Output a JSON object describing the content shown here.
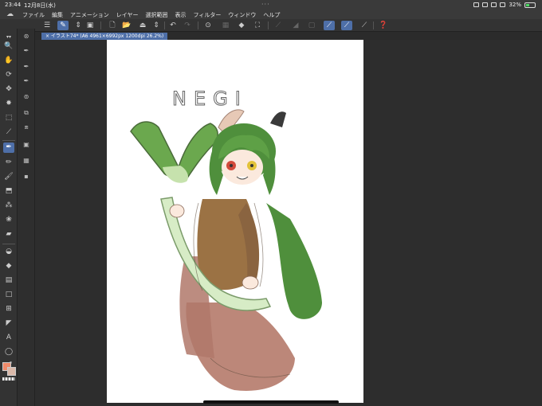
{
  "status": {
    "time": "23:44",
    "date": "12月8日(水)",
    "battery": "32%"
  },
  "menu": {
    "items": [
      "ファイル",
      "編集",
      "アニメーション",
      "レイヤー",
      "選択範囲",
      "表示",
      "フィルター",
      "ウィンドウ",
      "ヘルプ"
    ]
  },
  "document": {
    "tab_label": "× イラスト74* (A6 4961×6992px 1200dpi 26.2%)"
  },
  "artwork": {
    "title_text": "NEGI"
  },
  "colors": {
    "accent": "#4e6fa8",
    "main_color": "#f08a6a",
    "sub_color": "#d9b8a9"
  }
}
